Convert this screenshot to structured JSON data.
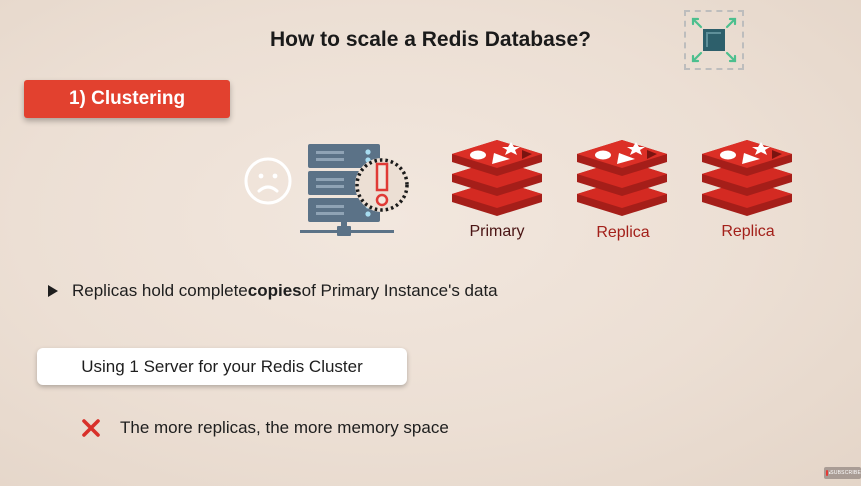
{
  "slide": {
    "title": "How to scale a Redis Database?",
    "section_label": "1) Clustering",
    "nodes": [
      {
        "label": "Primary"
      },
      {
        "label": "Replica"
      },
      {
        "label": "Replica"
      }
    ],
    "bullet": {
      "pre": "Replicas hold complete ",
      "bold": "copies",
      "post": " of Primary Instance's data"
    },
    "server_box_text": "Using 1 Server for your Redis Cluster",
    "con_text": "The more replicas, the more memory space"
  },
  "overlay": {
    "subscribe_label": "SUBSCRIBE"
  },
  "colors": {
    "accent_red": "#e2412f",
    "redis_red": "#d42a22",
    "server_blue": "#5b7287",
    "warning_red": "#e03a36",
    "expand_teal": "#2d5f6b",
    "expand_green": "#4cbf8e"
  },
  "icons": [
    "expand-icon",
    "sad-face-icon",
    "server-warning-icon",
    "redis-logo-icon",
    "cross-icon",
    "youtube-icon"
  ]
}
